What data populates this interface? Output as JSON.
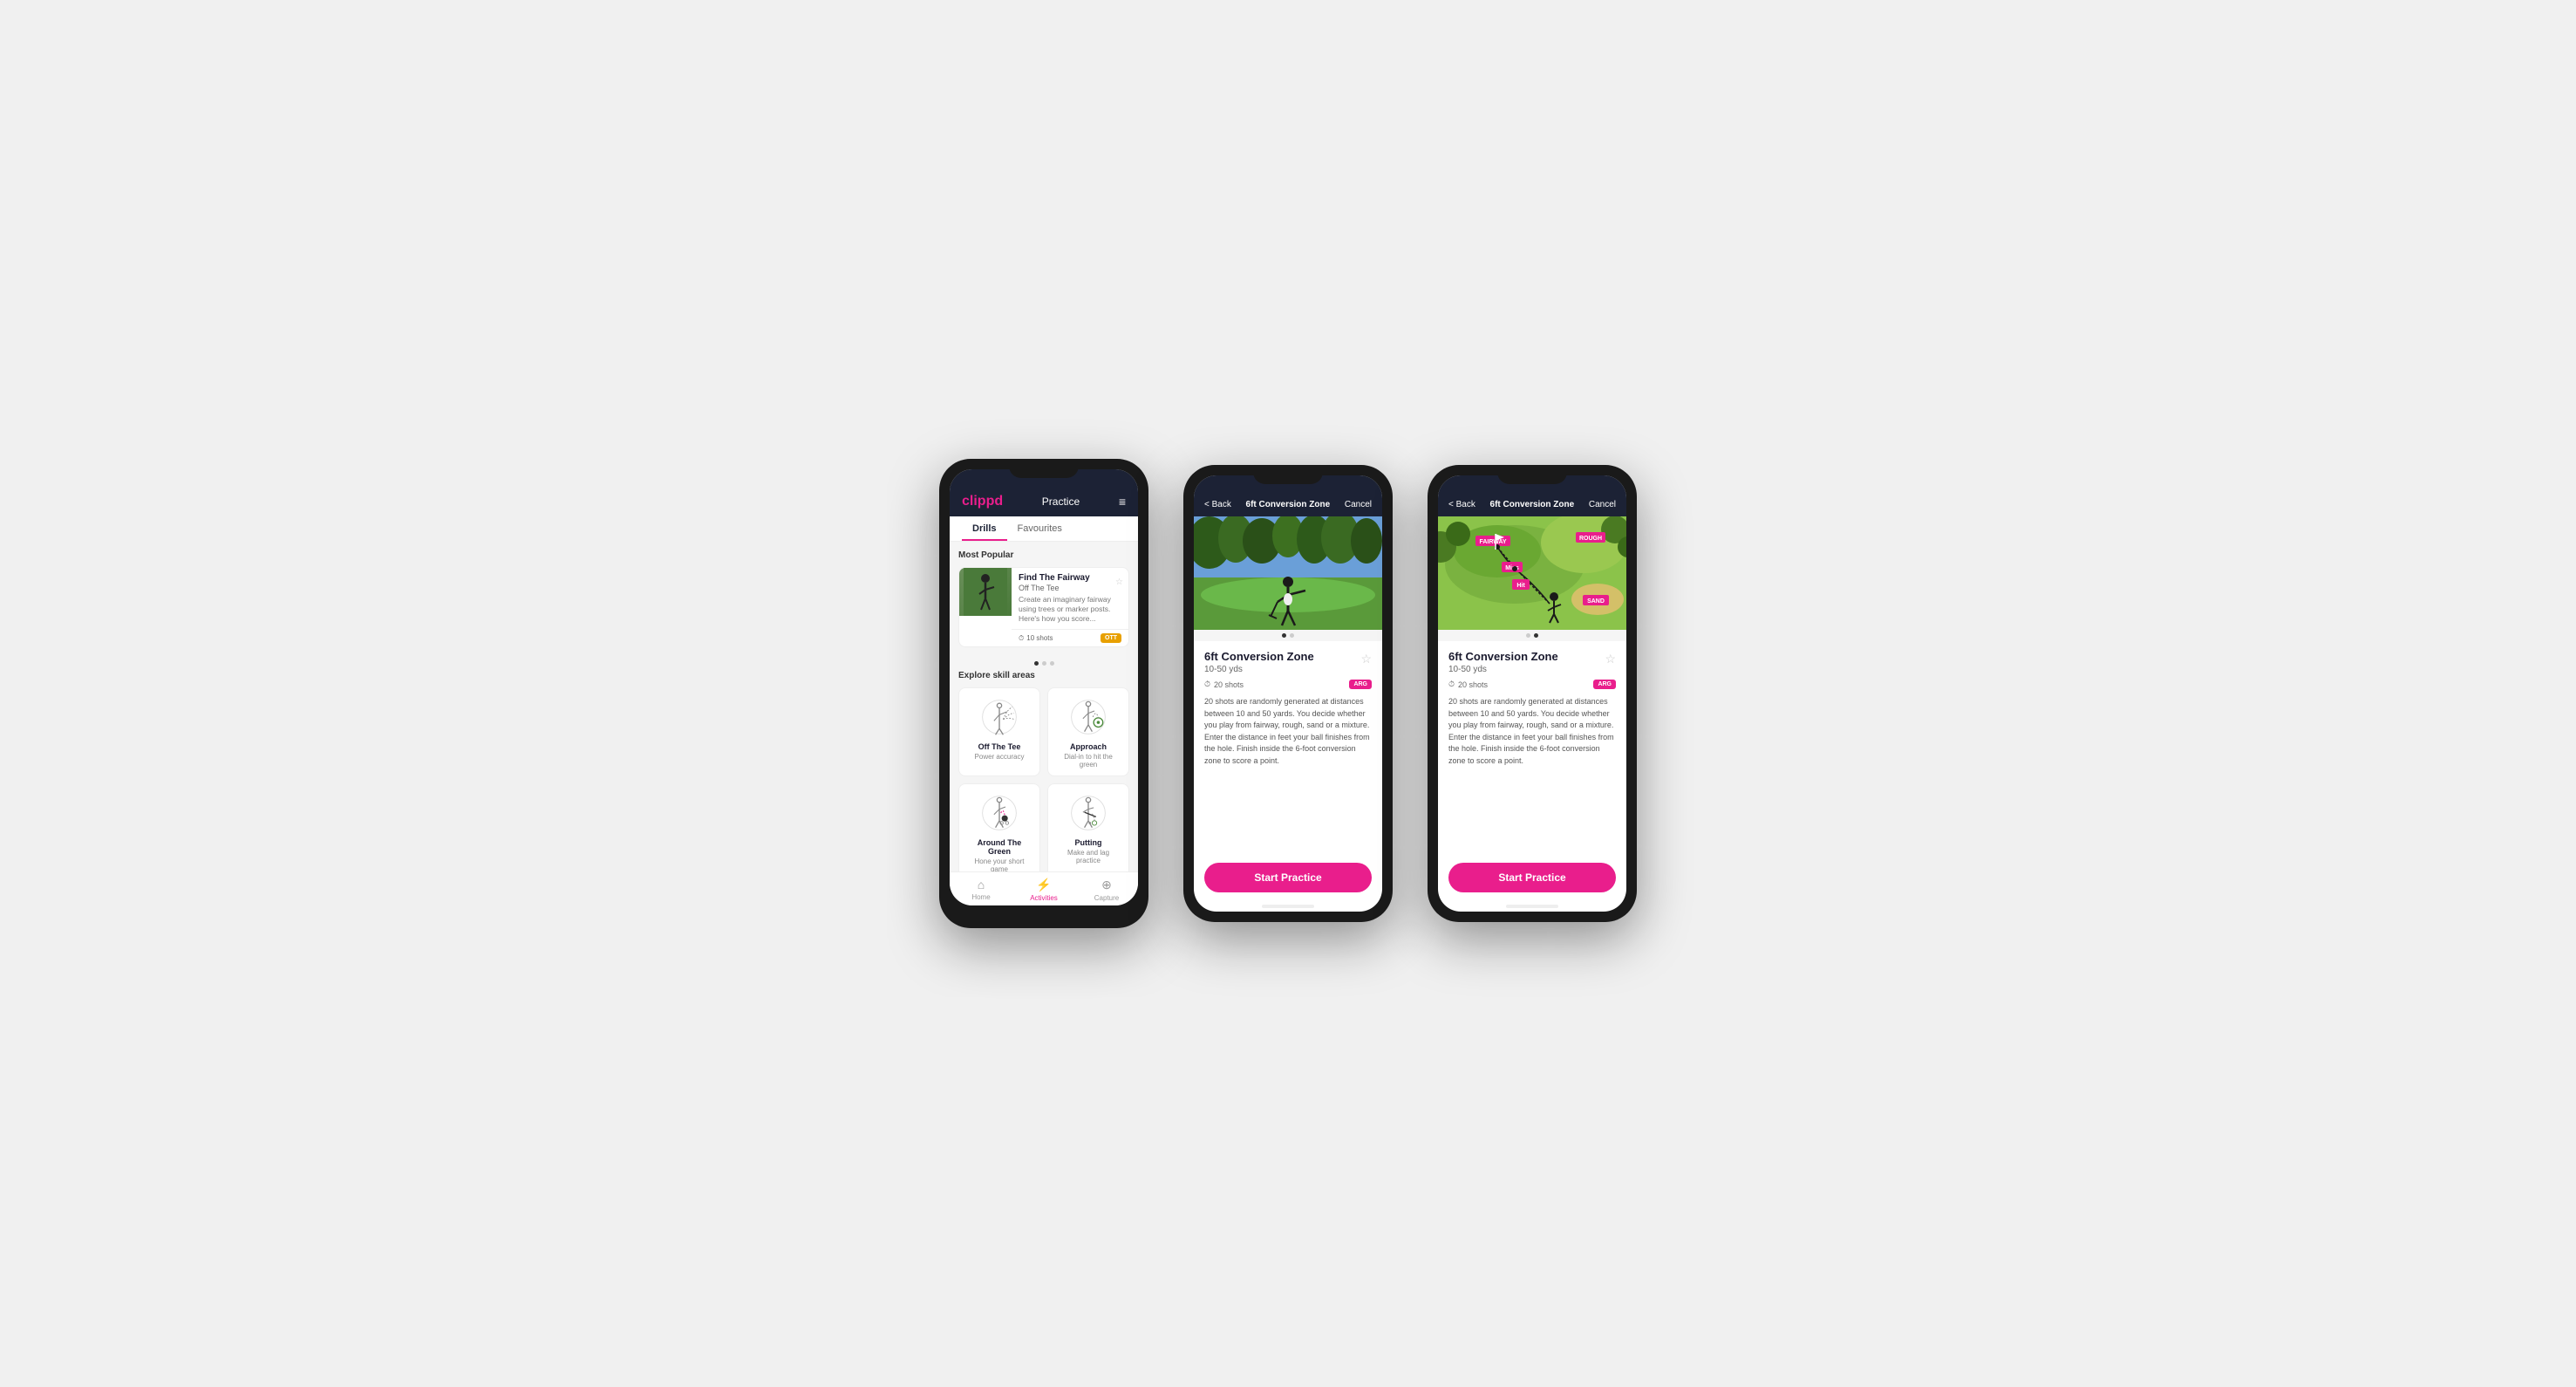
{
  "phone1": {
    "logo": "clippd",
    "header_title": "Practice",
    "tab_drills": "Drills",
    "tab_favourites": "Favourites",
    "most_popular_label": "Most Popular",
    "drill_name": "Find The Fairway",
    "drill_sub": "Off The Tee",
    "drill_desc": "Create an imaginary fairway using trees or marker posts. Here's how you score...",
    "drill_shots": "10 shots",
    "drill_tag": "OTT",
    "dots": [
      "active",
      "",
      ""
    ],
    "explore_label": "Explore skill areas",
    "skills": [
      {
        "name": "Off The Tee",
        "desc": "Power accuracy"
      },
      {
        "name": "Approach",
        "desc": "Dial-in to hit the green"
      },
      {
        "name": "Around The Green",
        "desc": "Hone your short game"
      },
      {
        "name": "Putting",
        "desc": "Make and lag practice"
      }
    ],
    "nav": [
      {
        "label": "Home",
        "active": false
      },
      {
        "label": "Activities",
        "active": true
      },
      {
        "label": "Capture",
        "active": false
      }
    ]
  },
  "phone2": {
    "back_label": "< Back",
    "header_title": "6ft Conversion Zone",
    "cancel_label": "Cancel",
    "drill_title": "6ft Conversion Zone",
    "drill_range": "10-50 yds",
    "shots_label": "20 shots",
    "tag": "ARG",
    "description": "20 shots are randomly generated at distances between 10 and 50 yards. You decide whether you play from fairway, rough, sand or a mixture. Enter the distance in feet your ball finishes from the hole. Finish inside the 6-foot conversion zone to score a point.",
    "start_label": "Start Practice"
  },
  "phone3": {
    "back_label": "< Back",
    "header_title": "6ft Conversion Zone",
    "cancel_label": "Cancel",
    "drill_title": "6ft Conversion Zone",
    "drill_range": "10-50 yds",
    "shots_label": "20 shots",
    "tag": "ARG",
    "description": "20 shots are randomly generated at distances between 10 and 50 yards. You decide whether you play from fairway, rough, sand or a mixture. Enter the distance in feet your ball finishes from the hole. Finish inside the 6-foot conversion zone to score a point.",
    "start_label": "Start Practice",
    "map_labels": [
      "FAIRWAY",
      "ROUGH",
      "Miss",
      "Hit",
      "SAND"
    ]
  },
  "icons": {
    "clock": "⏱",
    "home": "⌂",
    "activities": "⚡",
    "capture": "⊕",
    "star": "☆",
    "chevron_left": "‹",
    "hamburger": "≡"
  }
}
